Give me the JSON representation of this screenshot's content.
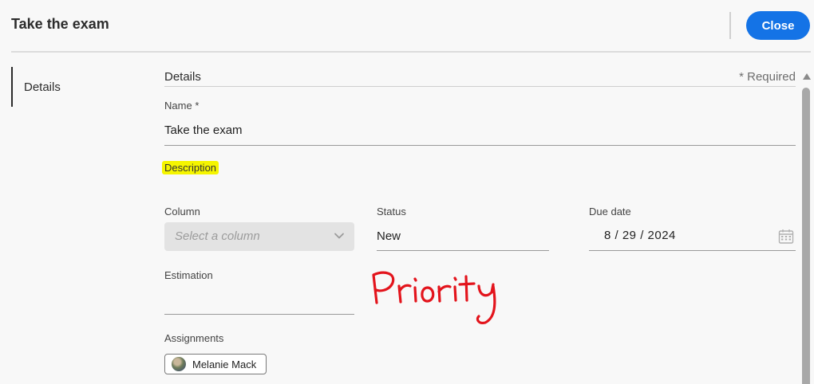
{
  "header": {
    "title": "Take the exam",
    "close_label": "Close"
  },
  "nav": {
    "items": [
      {
        "label": "Details",
        "active": true
      }
    ]
  },
  "form": {
    "section_title": "Details",
    "required_note": "* Required",
    "name": {
      "label": "Name",
      "required_mark": "*",
      "value": "Take the exam"
    },
    "description": {
      "label": "Description",
      "highlight_color": "#f5f500"
    },
    "column": {
      "label": "Column",
      "placeholder": "Select a column"
    },
    "status": {
      "label": "Status",
      "value": "New"
    },
    "due_date": {
      "label": "Due date",
      "value": "8 / 29 / 2024"
    },
    "estimation": {
      "label": "Estimation",
      "value": ""
    },
    "assignments": {
      "label": "Assignments",
      "assignees": [
        "Melanie Mack"
      ]
    }
  },
  "annotation": {
    "text": "Priority",
    "color": "#e3141c"
  },
  "colors": {
    "accent": "#1473e6"
  }
}
